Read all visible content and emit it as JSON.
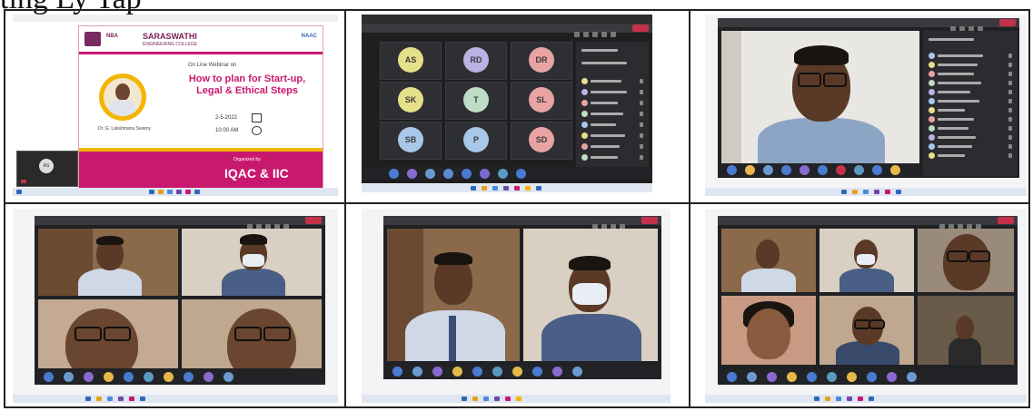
{
  "page": {
    "caption": "ting Ly Tap"
  },
  "poster": {
    "college_name": "SARASWATHI",
    "college_sub": "ENGINEERING COLLEGE",
    "badge1": "NBA",
    "badge2": "NAAC",
    "line1": "On Line Webinar on",
    "title": "How to plan for Start-up, Legal & Ethical Steps",
    "speaker": "Dr. G. Lakshmana Swamy",
    "date_text": "2-5-2022",
    "time_text": "10:00 AM",
    "organized_by": "Organized by",
    "footer": "IQAC & IIC"
  },
  "preview": {
    "self_initials": "AS"
  },
  "gallery": {
    "rows": [
      [
        "AS",
        "RD",
        "DR"
      ],
      [
        "SK",
        "T",
        "SL"
      ],
      [
        "SB",
        "P",
        "SD"
      ]
    ]
  },
  "colors": {
    "teams_dark": "#2b2b2b",
    "leave_red": "#c4314b",
    "bubble_yellow": "#e6e08a",
    "bubble_purple": "#b9b2e3",
    "bubble_red": "#e8a3a3",
    "bubble_green": "#bfdcc4",
    "bubble_blue": "#a9c7e9",
    "poster_magenta": "#c8186f",
    "poster_yellow": "#f2b600"
  }
}
